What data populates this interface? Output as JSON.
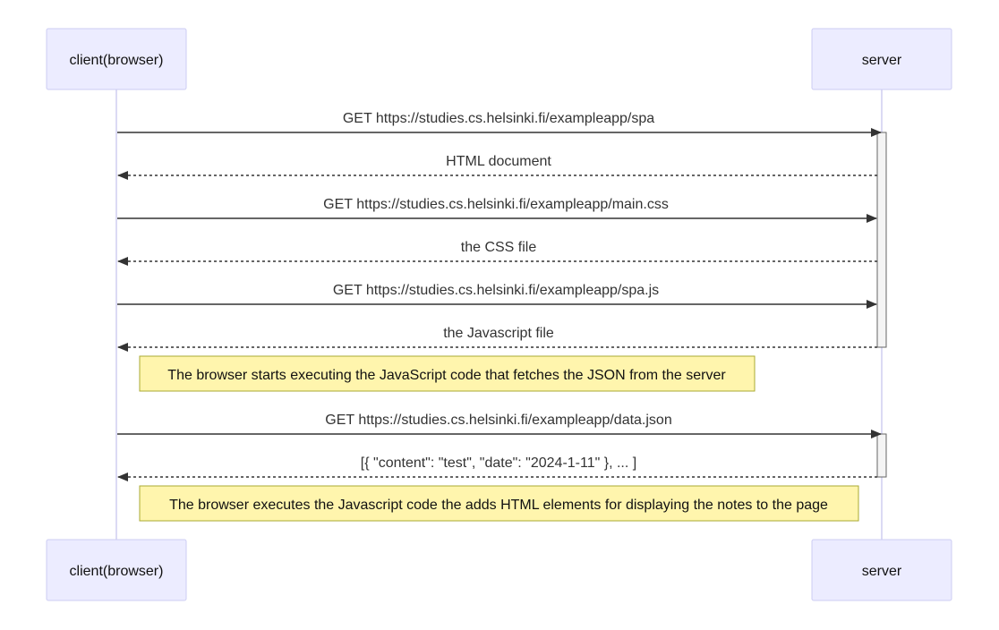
{
  "actors": {
    "client": "client(browser)",
    "server": "server"
  },
  "messages": [
    {
      "text": "GET https://studies.cs.helsinki.fi/exampleapp/spa",
      "direction": "request",
      "style": "solid"
    },
    {
      "text": "HTML document",
      "direction": "response",
      "style": "dashed"
    },
    {
      "text": "GET https://studies.cs.helsinki.fi/exampleapp/main.css",
      "direction": "request",
      "style": "solid"
    },
    {
      "text": "the CSS file",
      "direction": "response",
      "style": "dashed"
    },
    {
      "text": "GET https://studies.cs.helsinki.fi/exampleapp/spa.js",
      "direction": "request",
      "style": "solid"
    },
    {
      "text": "the Javascript file",
      "direction": "response",
      "style": "dashed"
    },
    {
      "text": "GET https://studies.cs.helsinki.fi/exampleapp/data.json",
      "direction": "request",
      "style": "solid"
    },
    {
      "text": "[{ \"content\": \"test\", \"date\": \"2024-1-11\" }, ... ]",
      "direction": "response",
      "style": "dashed"
    }
  ],
  "notes": [
    {
      "text": "The browser starts executing the JavaScript code that fetches the JSON from the server"
    },
    {
      "text": "The browser executes the Javascript code the adds HTML elements for displaying the notes to the page"
    }
  ],
  "colors": {
    "actor_fill": "#ECECFF",
    "note_fill": "#fff5ad",
    "line": "#333333"
  }
}
